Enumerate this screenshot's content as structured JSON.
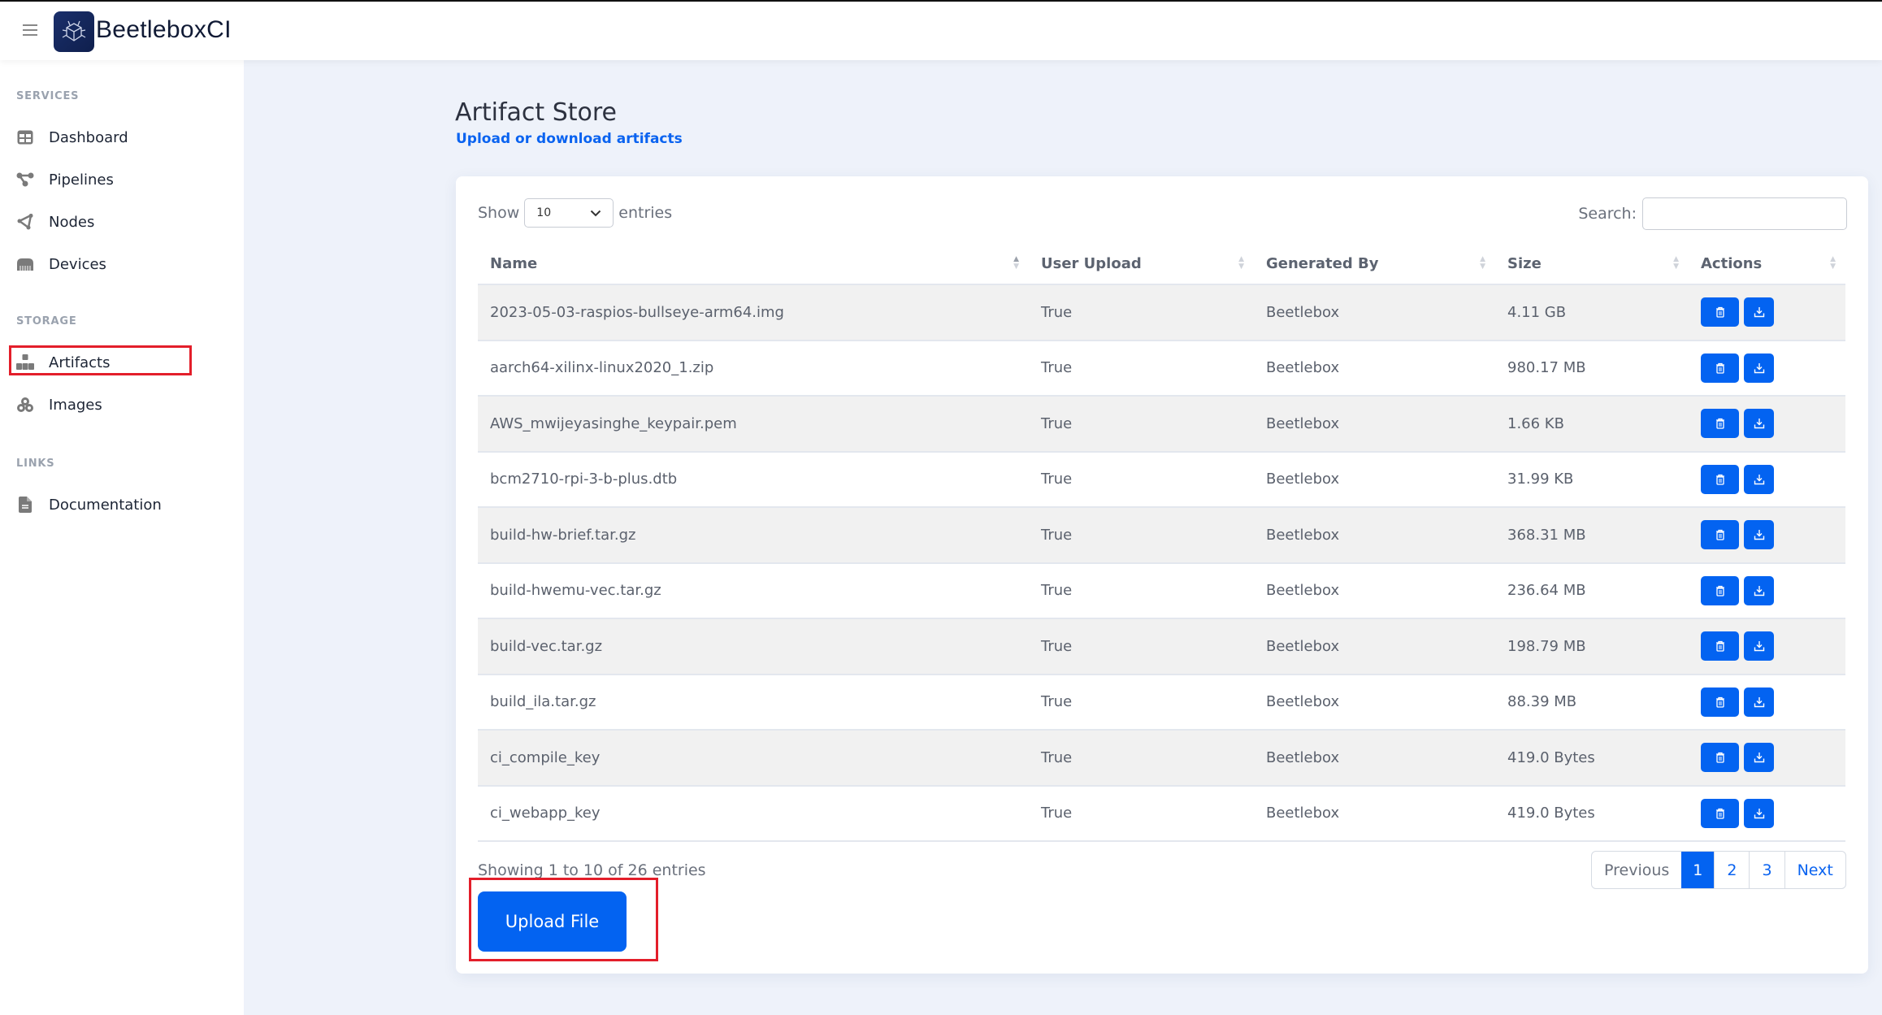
{
  "app": {
    "brand": "BeetleboxCI"
  },
  "sidebar": {
    "sections": [
      {
        "label": "SERVICES"
      },
      {
        "label": "STORAGE"
      },
      {
        "label": "LINKS"
      }
    ],
    "items": [
      {
        "label": "Dashboard",
        "icon": "dashboard-icon"
      },
      {
        "label": "Pipelines",
        "icon": "pipelines-icon"
      },
      {
        "label": "Nodes",
        "icon": "nodes-icon"
      },
      {
        "label": "Devices",
        "icon": "devices-icon"
      },
      {
        "label": "Artifacts",
        "icon": "artifacts-icon"
      },
      {
        "label": "Images",
        "icon": "images-icon"
      },
      {
        "label": "Documentation",
        "icon": "document-icon"
      }
    ]
  },
  "page": {
    "title": "Artifact Store",
    "subtitle": "Upload or download artifacts"
  },
  "table_controls": {
    "show_label": "Show",
    "entries_label": "entries",
    "page_length": "10",
    "search_label": "Search:",
    "search_value": ""
  },
  "table": {
    "columns": [
      "Name",
      "User Upload",
      "Generated By",
      "Size",
      "Actions"
    ],
    "rows": [
      {
        "name": "2023-05-03-raspios-bullseye-arm64.img",
        "user_upload": "True",
        "generated_by": "Beetlebox",
        "size": "4.11 GB"
      },
      {
        "name": "aarch64-xilinx-linux2020_1.zip",
        "user_upload": "True",
        "generated_by": "Beetlebox",
        "size": "980.17 MB"
      },
      {
        "name": "AWS_mwijeyasinghe_keypair.pem",
        "user_upload": "True",
        "generated_by": "Beetlebox",
        "size": "1.66 KB"
      },
      {
        "name": "bcm2710-rpi-3-b-plus.dtb",
        "user_upload": "True",
        "generated_by": "Beetlebox",
        "size": "31.99 KB"
      },
      {
        "name": "build-hw-brief.tar.gz",
        "user_upload": "True",
        "generated_by": "Beetlebox",
        "size": "368.31 MB"
      },
      {
        "name": "build-hwemu-vec.tar.gz",
        "user_upload": "True",
        "generated_by": "Beetlebox",
        "size": "236.64 MB"
      },
      {
        "name": "build-vec.tar.gz",
        "user_upload": "True",
        "generated_by": "Beetlebox",
        "size": "198.79 MB"
      },
      {
        "name": "build_ila.tar.gz",
        "user_upload": "True",
        "generated_by": "Beetlebox",
        "size": "88.39 MB"
      },
      {
        "name": "ci_compile_key",
        "user_upload": "True",
        "generated_by": "Beetlebox",
        "size": "419.0 Bytes"
      },
      {
        "name": "ci_webapp_key",
        "user_upload": "True",
        "generated_by": "Beetlebox",
        "size": "419.0 Bytes"
      }
    ]
  },
  "footer": {
    "info": "Showing 1 to 10 of 26 entries",
    "pagination": {
      "previous": "Previous",
      "pages": [
        "1",
        "2",
        "3"
      ],
      "current": "1",
      "next": "Next"
    },
    "upload_label": "Upload File"
  },
  "colors": {
    "accent": "#0363f1",
    "highlight": "#e31e2a",
    "brand_bg": "#1a2f6b"
  }
}
